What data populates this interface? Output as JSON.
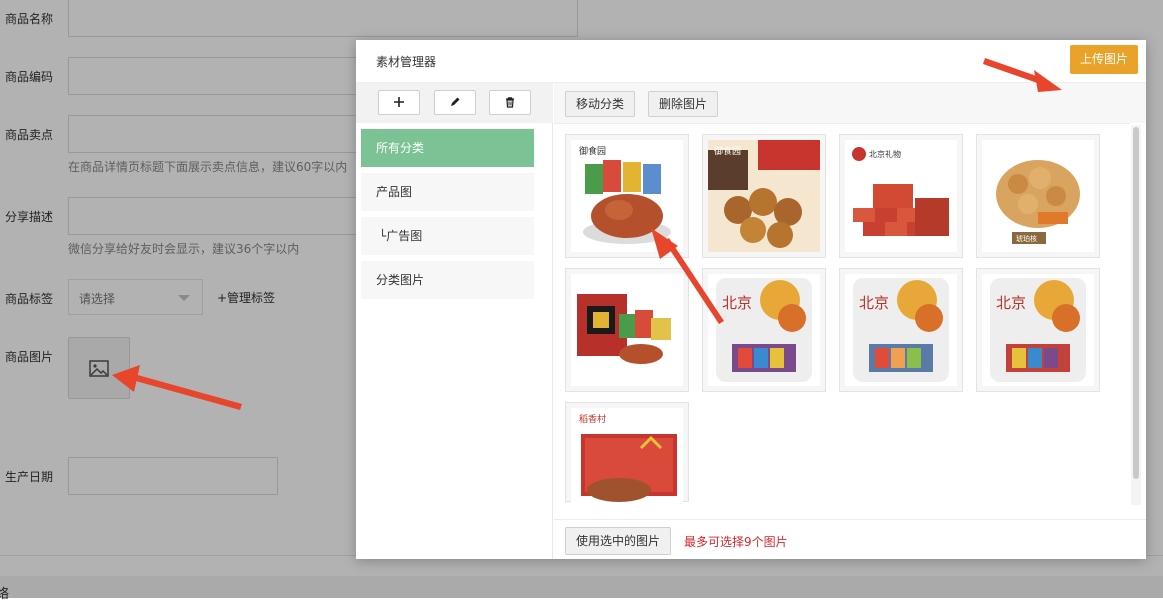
{
  "form": {
    "fields": [
      {
        "label": "商品名称"
      },
      {
        "label": "商品编码"
      },
      {
        "label": "商品卖点",
        "hint": "在商品详情页标题下面展示卖点信息，建议60字以内"
      },
      {
        "label": "分享描述",
        "hint": "微信分享给好友时会显示，建议36个字以内"
      },
      {
        "label": "商品标签",
        "select_placeholder": "请选择",
        "manage_link": "+管理标签"
      },
      {
        "label": "商品图片"
      },
      {
        "label": "生产日期"
      }
    ],
    "bottom_text": "络"
  },
  "modal": {
    "title": "素材管理器",
    "left_toolbar": {
      "add_icon": "plus-icon",
      "edit_icon": "pencil-icon",
      "delete_icon": "trash-icon"
    },
    "categories": [
      {
        "label": "所有分类",
        "active": true
      },
      {
        "label": "产品图",
        "active": false
      },
      {
        "label": "└广告图",
        "active": false
      },
      {
        "label": "分类图片",
        "active": false
      }
    ],
    "toolbar": {
      "move_label": "移动分类",
      "delete_label": "删除图片",
      "upload_label": "上传图片"
    },
    "images": [
      {
        "brand": "御食园",
        "subject": "preserved-fruit-bowl"
      },
      {
        "brand": "御食园",
        "subject": "chestnuts"
      },
      {
        "brand": "北京礼物",
        "subject": "red-gift-boxes"
      },
      {
        "brand": "",
        "subject": "walnut-snack",
        "tag": "琥珀核"
      },
      {
        "brand": "",
        "subject": "snack-gift-set"
      },
      {
        "brand": "",
        "subject": "beijing-snack-bag",
        "text": "北京"
      },
      {
        "brand": "",
        "subject": "beijing-snack-bag",
        "text": "北京"
      },
      {
        "brand": "",
        "subject": "beijing-snack-bag",
        "text": "北京"
      },
      {
        "brand": "稻香村",
        "subject": "roast-duck-gift-box"
      }
    ],
    "footer": {
      "use_label": "使用选中的图片",
      "max_tip": "最多可选择9个图片"
    }
  },
  "colors": {
    "active_category": "#7bc394",
    "upload_button": "#e9a32a",
    "warning_text": "#d6262c",
    "annotation_arrow": "#e8452d"
  }
}
